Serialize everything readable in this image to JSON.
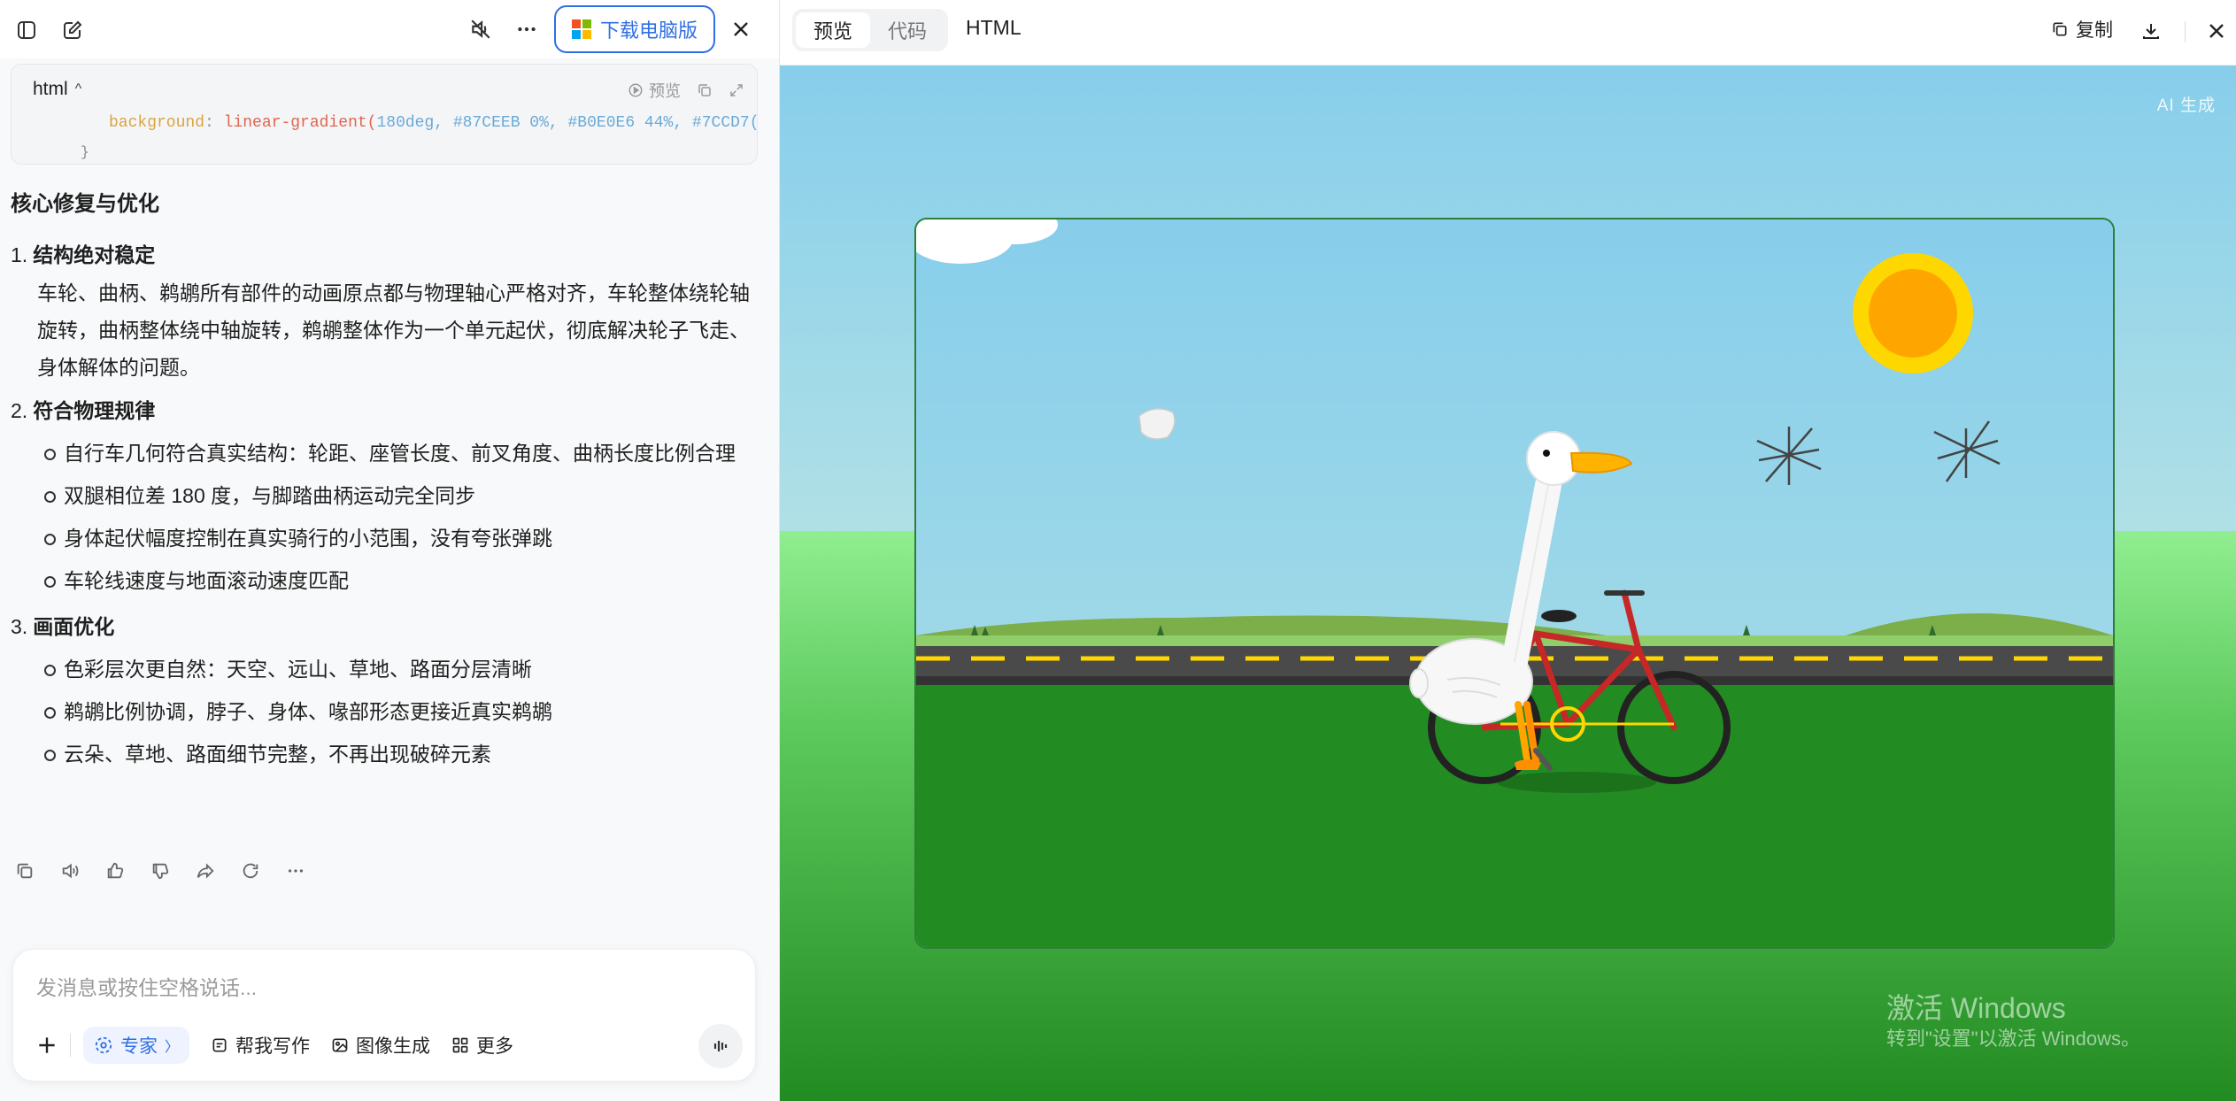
{
  "top_left": {
    "download_label": "下载电脑版"
  },
  "code_block": {
    "lang": "html",
    "preview_label": "预览",
    "line_prop": "background",
    "line_fn": "linear-gradient(",
    "line_args": "180deg, #87CEEB 0%, #B0E0E6 44%, #7CCD7("
  },
  "message": {
    "heading": "核心修复与优化",
    "sections": [
      {
        "num": "1.",
        "title": "结构绝对稳定",
        "paragraph": "车轮、曲柄、鹈鹕所有部件的动画原点都与物理轴心严格对齐，车轮整体绕轮轴旋转，曲柄整体绕中轴旋转，鹈鹕整体作为一个单元起伏，彻底解决轮子飞走、身体解体的问题。"
      },
      {
        "num": "2.",
        "title": "符合物理规律",
        "bullets": [
          "自行车几何符合真实结构：轮距、座管长度、前叉角度、曲柄长度比例合理",
          "双腿相位差 180 度，与脚踏曲柄运动完全同步",
          "身体起伏幅度控制在真实骑行的小范围，没有夸张弹跳",
          "车轮线速度与地面滚动速度匹配"
        ]
      },
      {
        "num": "3.",
        "title": "画面优化",
        "bullets": [
          "色彩层次更自然：天空、远山、草地、路面分层清晰",
          "鹈鹕比例协调，脖子、身体、喙部形态更接近真实鹈鹕",
          "云朵、草地、路面细节完整，不再出现破碎元素"
        ]
      }
    ]
  },
  "composer": {
    "placeholder": "发消息或按住空格说话...",
    "expert_label": "专家",
    "write_label": "帮我写作",
    "image_label": "图像生成",
    "more_label": "更多"
  },
  "preview_panel": {
    "tabs": [
      "预览",
      "代码"
    ],
    "active_tab": "预览",
    "lang_label": "HTML",
    "copy_label": "复制",
    "ai_badge": "AI 生成"
  },
  "watermark": {
    "line1": "激活 Windows",
    "line2": "转到\"设置\"以激活 Windows。"
  },
  "colors": {
    "accent_blue": "#2f6fe4",
    "sky_top": "#87CEEB",
    "sky_mid": "#B0E0E6",
    "grass": "#228B22",
    "sun": "#FFA500",
    "sun_halo": "#FFD700",
    "bike_frame": "#C62828",
    "road": "#4a4a4a",
    "road_line": "#FFD700"
  }
}
